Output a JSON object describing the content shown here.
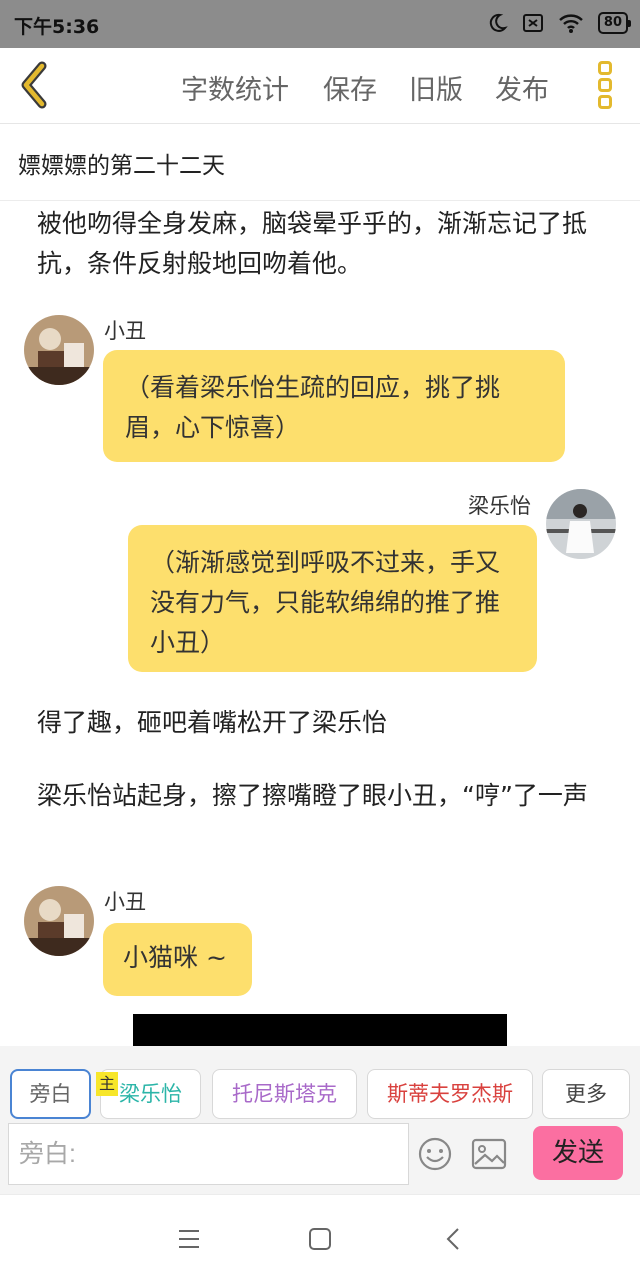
{
  "status_bar": {
    "time": "下午5:36",
    "battery": "80",
    "icons": [
      "moon-icon",
      "sim-off-icon",
      "wifi-icon",
      "battery-icon"
    ]
  },
  "toolbar": {
    "word_count": "字数统计",
    "save": "保存",
    "old_version": "旧版",
    "publish": "发布",
    "accent_color": "#e3b92e"
  },
  "chapter": {
    "title": "嫖嫖嫖的第二十二天"
  },
  "content": {
    "narration_1": "被他吻得全身发麻，脑袋晕乎乎的，渐渐忘记了抵抗，条件反射般地回吻着他。",
    "msg_1": {
      "name": "小丑",
      "text": "（看着梁乐怡生疏的回应，挑了挑眉，心下惊喜）"
    },
    "msg_2": {
      "name": "梁乐怡",
      "text": "（渐渐感觉到呼吸不过来，手又没有力气，只能软绵绵的推了推小丑）"
    },
    "narration_2": "得了趣，砸吧着嘴松开了梁乐怡",
    "narration_3": "梁乐怡站起身，擦了擦嘴瞪了眼小丑，“哼”了一声",
    "msg_3": {
      "name": "小丑",
      "text": "小猫咪 ~"
    },
    "bubble_color": "#fddf6d"
  },
  "input_panel": {
    "roles": [
      {
        "label": "旁白",
        "color": "#666666"
      },
      {
        "label": "梁乐怡",
        "color": "#2bb5a8"
      },
      {
        "label": "托尼斯塔克",
        "color": "#a869c9"
      },
      {
        "label": "斯蒂夫罗杰斯",
        "color": "#d9413e"
      },
      {
        "label": "更多",
        "color": "#444444"
      }
    ],
    "main_badge": "主",
    "placeholder": "旁白:",
    "send": "发送",
    "send_color": "#fb6fa1"
  }
}
